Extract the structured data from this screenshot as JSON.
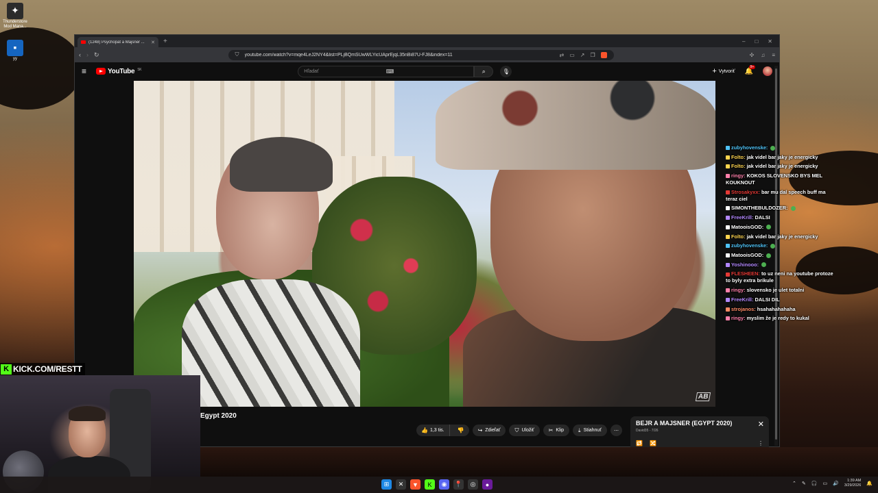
{
  "desktop": {
    "icons": [
      {
        "label": "Thunderstore Mod Mana...",
        "glyph": "✦"
      },
      {
        "label": "yy",
        "glyph": "▪"
      }
    ]
  },
  "browser": {
    "tab_title": "(1248) Psychopat a Majsner ...",
    "new_tab": "+",
    "window_controls": [
      "–",
      "□",
      "✕"
    ],
    "url": "youtube.com/watch?v=mqe4LeJ2NY4&list=PLjBQmSUwWLYicUAprEjqL35nBi87U-FJ8&index=11"
  },
  "youtube": {
    "logo_text": "YouTube",
    "region": "SK",
    "search_placeholder": "Hľadať",
    "create_label": "Vytvoriť",
    "notif_count": "9+",
    "video_title": "Egypt 2020",
    "actions": {
      "likes": "1,3 tis.",
      "share": "Zdieľať",
      "save": "Uložiť",
      "clip": "Klip",
      "download": "Stiahnuť"
    },
    "playlist": {
      "title": "BEJR A MAJSNER (EGYPT 2020)",
      "sub": "David35 - 7/26"
    },
    "watermark": "AB"
  },
  "chat": [
    {
      "user": "zubyhovenske:",
      "text": "",
      "color": "#4fc3f7"
    },
    {
      "user": "Folto:",
      "text": "jak videl bar jaky je energicky",
      "color": "#ffd54f"
    },
    {
      "user": "Folto:",
      "text": "jak videl bar jaky je energicky",
      "color": "#ffd54f"
    },
    {
      "user": "ringy:",
      "text": "KOKOS SLOVENSKO BYS MEL KOUKNOUT",
      "color": "#ff80ab"
    },
    {
      "user": "Strosakyxx:",
      "text": "bar mu dal speech buff ma teraz ciel",
      "color": "#e53935"
    },
    {
      "user": "SIMONTHEBULDOZER:",
      "text": "",
      "color": "#ffffff"
    },
    {
      "user": "FreeKrill:",
      "text": "DALSI",
      "color": "#b388ff"
    },
    {
      "user": "MatooisGOD:",
      "text": "",
      "color": "#ffffff"
    },
    {
      "user": "Folto:",
      "text": "jak videl bar jaky je energicky",
      "color": "#ffd54f"
    },
    {
      "user": "zubyhovenske:",
      "text": "",
      "color": "#4fc3f7"
    },
    {
      "user": "MatooisGOD:",
      "text": "",
      "color": "#ffffff"
    },
    {
      "user": "Yoshinooo:",
      "text": "",
      "color": "#b388ff"
    },
    {
      "user": "FLESHEEN:",
      "text": "to uz neni na youtube protoze to byly extra brikule",
      "color": "#e53935"
    },
    {
      "user": "ringy:",
      "text": "slovensko je ulet totalni",
      "color": "#ff80ab"
    },
    {
      "user": "FreeKrill:",
      "text": "DALSI DIL",
      "color": "#b388ff"
    },
    {
      "user": "strojanos:",
      "text": "hsahahahahaha",
      "color": "#ff8a65"
    },
    {
      "user": "ringy:",
      "text": "myslim že je redy to kukal",
      "color": "#ff80ab"
    }
  ],
  "stream": {
    "kick_handle": "KICK.COM/RESTT",
    "kick_letter": "K"
  },
  "taskbar": {
    "time": "1:39 AM",
    "date": "3/29/2026"
  }
}
